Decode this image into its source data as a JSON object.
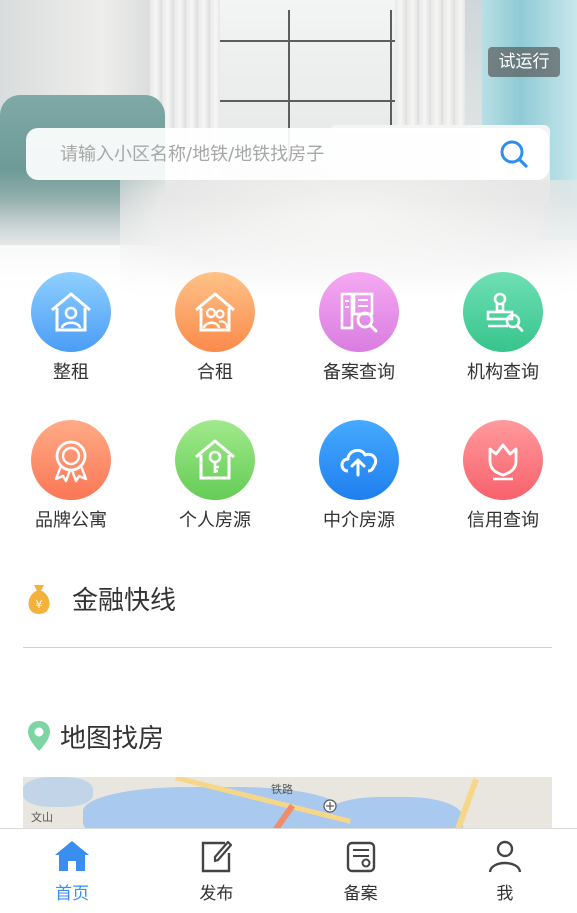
{
  "header": {
    "trial_label": "试运行"
  },
  "search": {
    "placeholder": "请输入小区名称/地铁/地铁找房子"
  },
  "categories": [
    {
      "label": "整租",
      "icon": "house-person-icon",
      "color": "#5aa9f8"
    },
    {
      "label": "合租",
      "icon": "house-people-icon",
      "color": "#fd9e5a"
    },
    {
      "label": "备案查询",
      "icon": "document-search-icon",
      "color": "#e790e4"
    },
    {
      "label": "机构查询",
      "icon": "stamp-search-icon",
      "color": "#45cf9b"
    },
    {
      "label": "品牌公寓",
      "icon": "award-ribbon-icon",
      "color": "#fd8a63"
    },
    {
      "label": "个人房源",
      "icon": "house-key-icon",
      "color": "#7fd66a"
    },
    {
      "label": "中介房源",
      "icon": "cloud-upload-icon",
      "color": "#2d8ef5"
    },
    {
      "label": "信用查询",
      "icon": "shield-flower-icon",
      "color": "#fd6f7b"
    }
  ],
  "finance": {
    "title": "金融快线",
    "icon": "money-bag-icon",
    "icon_color": "#f3b23b"
  },
  "map_section": {
    "title": "地图找房",
    "icon": "location-pin-icon",
    "icon_color": "#7dd5a4",
    "map_labels": [
      "文山",
      "铁路"
    ]
  },
  "tabbar": {
    "items": [
      {
        "label": "首页",
        "icon": "home-icon",
        "active": true
      },
      {
        "label": "发布",
        "icon": "edit-icon",
        "active": false
      },
      {
        "label": "备案",
        "icon": "record-icon",
        "active": false
      },
      {
        "label": "我",
        "icon": "user-icon",
        "active": false
      }
    ],
    "active_color": "#3a8ef0"
  }
}
